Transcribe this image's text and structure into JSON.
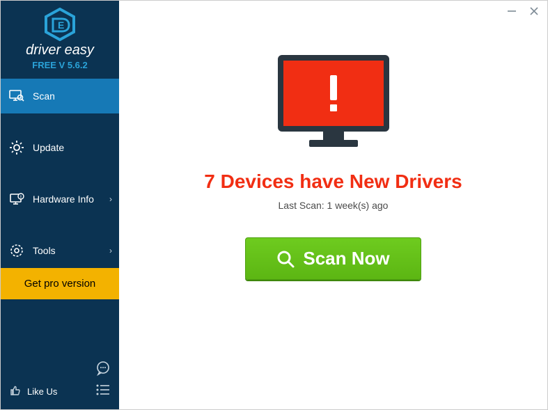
{
  "brand": {
    "name": "driver easy",
    "version": "FREE V 5.6.2"
  },
  "sidebar": {
    "items": [
      {
        "label": "Scan"
      },
      {
        "label": "Update"
      },
      {
        "label": "Hardware Info"
      },
      {
        "label": "Tools"
      }
    ],
    "get_pro": "Get pro version",
    "like_us": "Like Us"
  },
  "main": {
    "headline": "7 Devices have New Drivers",
    "last_scan": "Last Scan: 1 week(s) ago",
    "scan_button": "Scan Now"
  },
  "colors": {
    "accent_red": "#f12e13",
    "sidebar_bg": "#0b3352",
    "active_nav": "#1679b6",
    "pro_bg": "#f3b200",
    "scan_green": "#5cb613"
  }
}
